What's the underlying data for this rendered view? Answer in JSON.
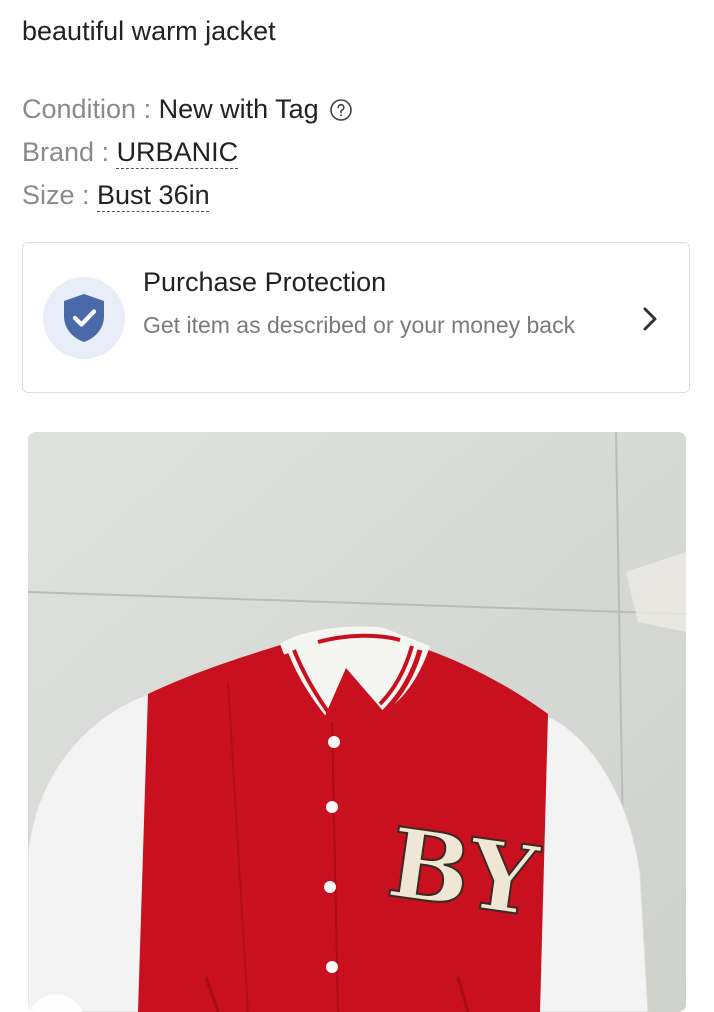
{
  "product": {
    "description": "beautiful warm jacket",
    "condition_label": "Condition : ",
    "condition_value": "New with Tag",
    "brand_label": "Brand : ",
    "brand_value": "URBANIC",
    "size_label": "Size : ",
    "size_value": "Bust 36in"
  },
  "protection": {
    "title": "Purchase Protection",
    "subtitle": "Get item as described or your money back"
  },
  "photo": {
    "patch_text": "BY"
  },
  "icons": {
    "info": "help-circle-icon",
    "shield": "shield-check-icon",
    "chevron": "chevron-right-icon"
  },
  "colors": {
    "shield": "#4a69a8",
    "shield_bg": "#e9edf7",
    "jacket_red": "#c8101e"
  }
}
